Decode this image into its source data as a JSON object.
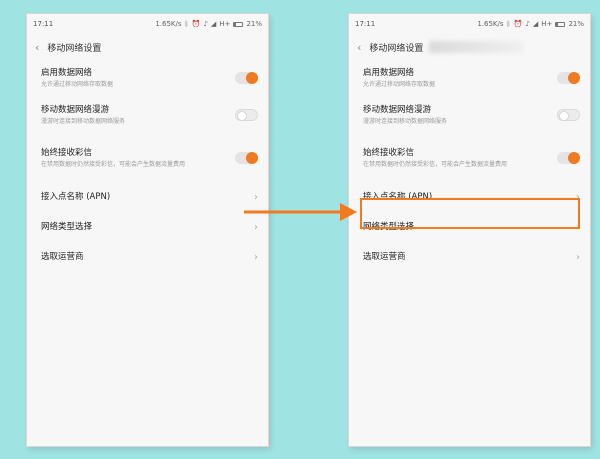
{
  "status_bar": {
    "time": "17:11",
    "network_speed": "1.65K/s",
    "network_type": "H+",
    "battery": "21%",
    "icons": [
      "bluetooth-icon",
      "alarm-icon",
      "mute-icon",
      "signal-icon",
      "battery-icon"
    ]
  },
  "header": {
    "title": "移动网络设置",
    "back_icon": "chevron-left-icon"
  },
  "settings": [
    {
      "title": "启用数据网络",
      "subtitle": "允许通过移动网络存取数据",
      "control": "toggle",
      "state": "on"
    },
    {
      "title": "移动数据网络漫游",
      "subtitle": "漫游时连接到移动数据网络服务",
      "control": "toggle",
      "state": "off"
    },
    {
      "title": "始终接收彩信",
      "subtitle": "在禁用数据时仍然接受彩信，可能会产生数据流量费用",
      "control": "toggle",
      "state": "on"
    },
    {
      "title": "接入点名称 (APN)",
      "control": "chevron"
    },
    {
      "title": "网络类型选择",
      "control": "chevron"
    },
    {
      "title": "选取运营商",
      "control": "chevron"
    }
  ],
  "chevron_glyph": "›",
  "annotation": {
    "arrow_color": "#f07a1d",
    "highlight_color": "#f07a1d",
    "highlighted_item": "接入点名称 (APN)"
  },
  "colors": {
    "background": "#9fe3e2",
    "accent": "#f07a1d",
    "screen": "#f7f7f7"
  }
}
